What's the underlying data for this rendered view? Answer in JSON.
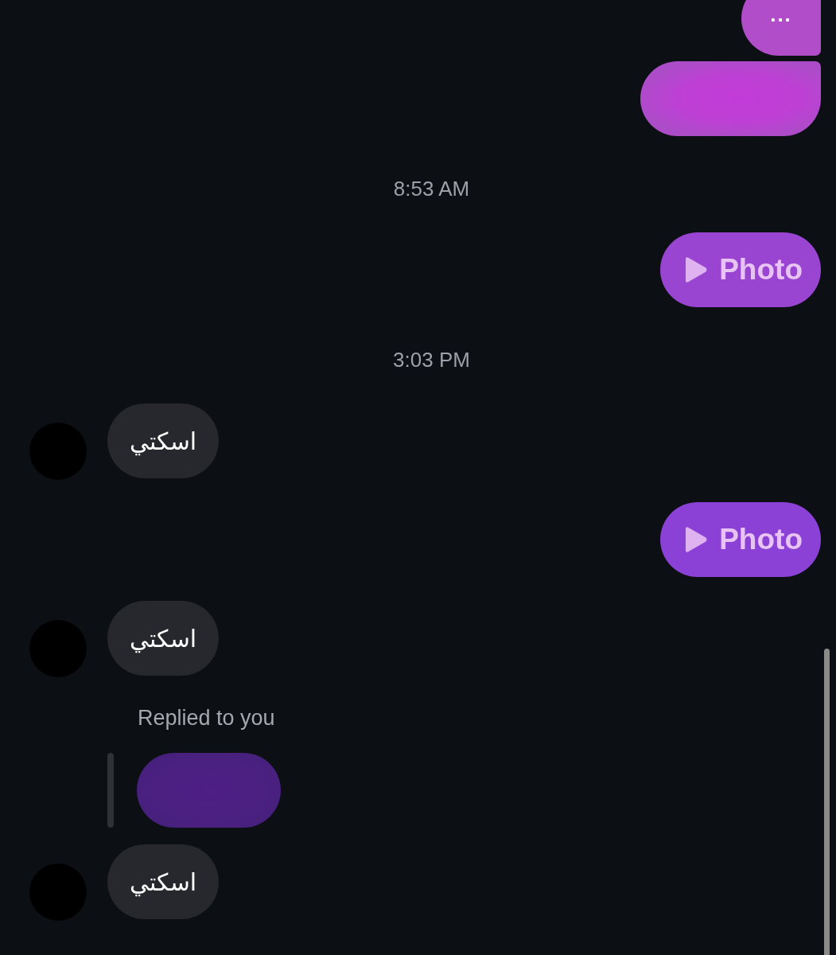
{
  "messages": [
    {
      "kind": "sent_text",
      "text": "..."
    },
    {
      "kind": "sent_redacted"
    },
    {
      "kind": "timestamp",
      "text": "8:53 AM"
    },
    {
      "kind": "sent_photo",
      "label": "Photo"
    },
    {
      "kind": "timestamp",
      "text": "3:03 PM"
    },
    {
      "kind": "received_text",
      "text": "اسكتي"
    },
    {
      "kind": "sent_photo",
      "label": "Photo"
    },
    {
      "kind": "received_text",
      "text": "اسكتي"
    },
    {
      "kind": "reply_label",
      "text": "Replied to you"
    },
    {
      "kind": "reply_quote"
    },
    {
      "kind": "received_text",
      "text": "اسكتي"
    }
  ]
}
